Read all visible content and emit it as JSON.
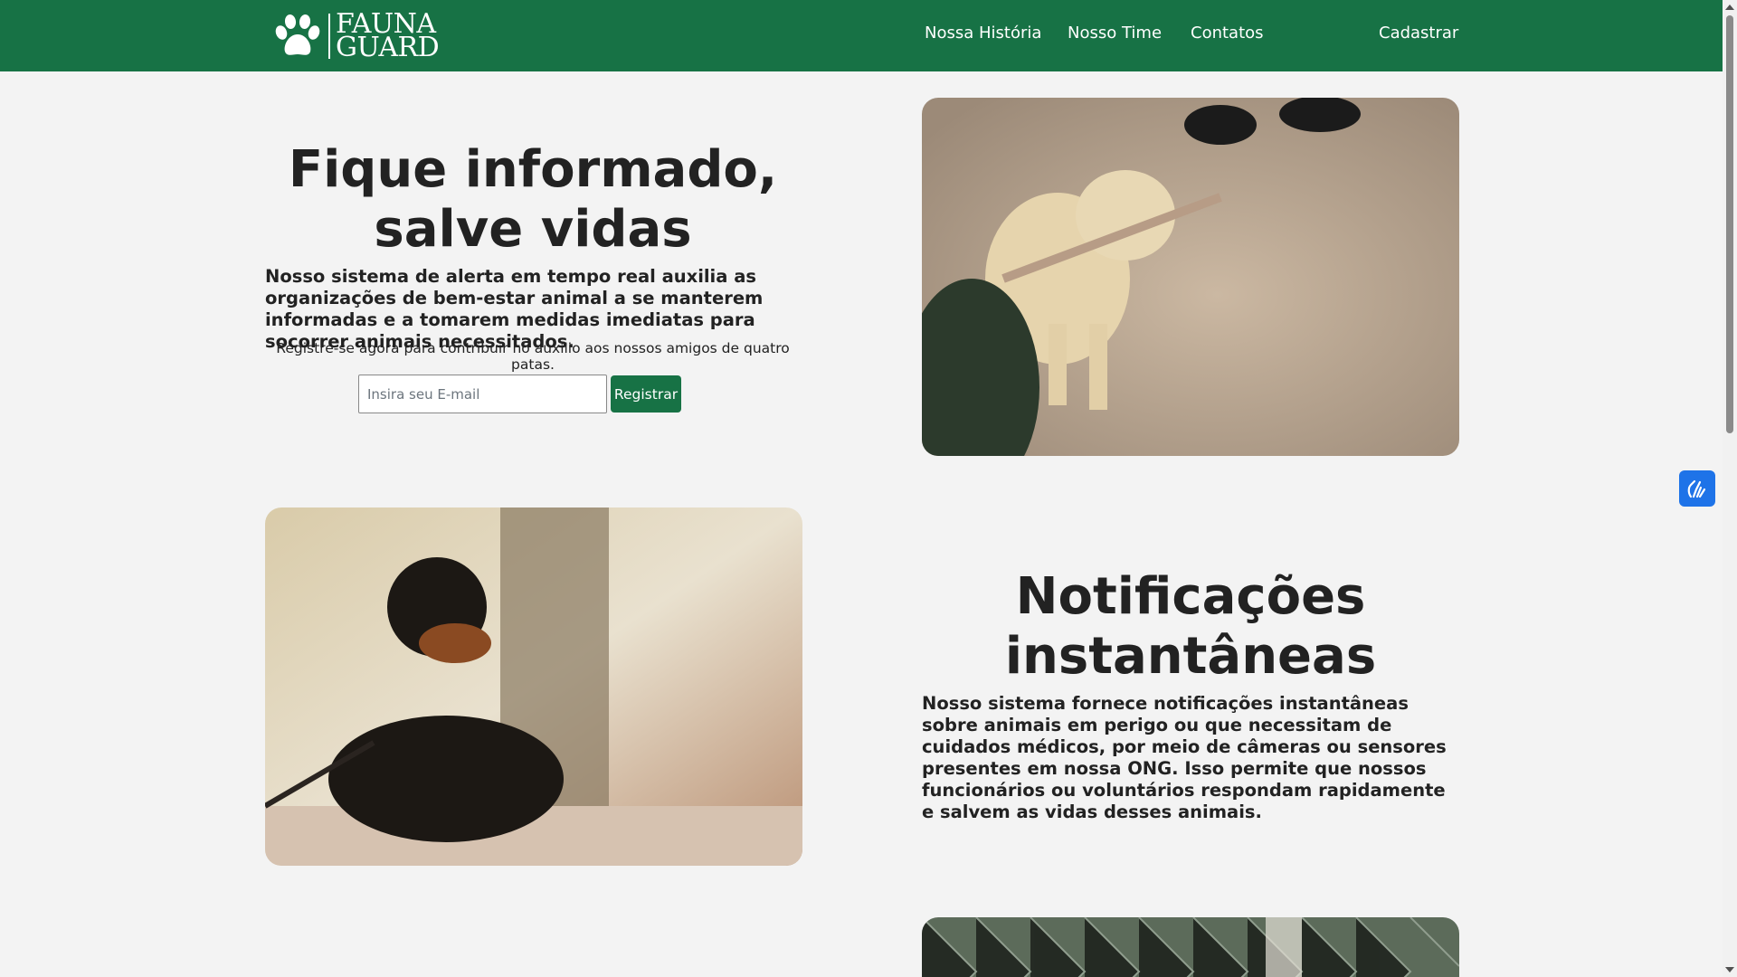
{
  "brand": {
    "name_line1": "FAUNA",
    "name_line2": "GUARD"
  },
  "nav": {
    "links": [
      "Nossa História",
      "Nosso Time",
      "Contatos"
    ],
    "signup": "Cadastrar"
  },
  "hero": {
    "title": "Fique informado, salve vidas",
    "description": "Nosso sistema de alerta em tempo real auxilia as organizações de bem-estar animal a se manterem informadas e a tomarem medidas imediatas para socorrer animais necessitados.",
    "subtitle": "Registre-se agora para contribuir no auxílio aos nossos amigos de quatro patas.",
    "email_placeholder": "Insira seu E-mail",
    "button_label": "Registrar"
  },
  "feature": {
    "title": "Notificações instantâneas",
    "description": "Nosso sistema fornece notificações instantâneas sobre animais em perigo ou que necessitam de cuidados médicos, por meio de câmeras ou sensores presentes em nossa ONG. Isso permite que nossos funcionários ou voluntários respondam rapidamente e salvem as vidas desses animais."
  },
  "icons": {
    "logo": "paw-icon",
    "accessibility": "sign-language-hands-icon"
  },
  "colors": {
    "brand_green": "#177245",
    "background": "#f3f3f3",
    "accessibility_blue": "#1e73e8"
  }
}
